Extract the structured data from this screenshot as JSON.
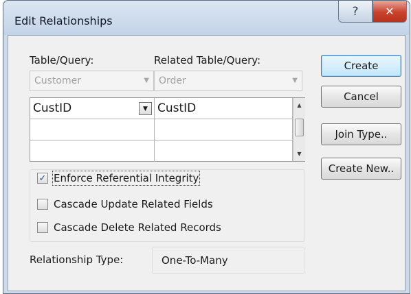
{
  "window": {
    "title": "Edit Relationships",
    "help_glyph": "?",
    "close_glyph": "✕"
  },
  "labels": {
    "table_query": "Table/Query:",
    "related_table_query": "Related Table/Query:",
    "relationship_type": "Relationship Type:"
  },
  "combos": {
    "table_value": "Customer",
    "related_value": "Order"
  },
  "fields_grid": {
    "rows": [
      {
        "left": "CustID",
        "right": "CustID"
      },
      {
        "left": "",
        "right": ""
      },
      {
        "left": "",
        "right": ""
      }
    ]
  },
  "options": {
    "enforce_integrity": {
      "label": "Enforce Referential Integrity",
      "checked": true
    },
    "cascade_update": {
      "label": "Cascade Update Related Fields",
      "checked": false
    },
    "cascade_delete": {
      "label": "Cascade Delete Related Records",
      "checked": false
    }
  },
  "relationship_type_value": "One-To-Many",
  "buttons": {
    "create": "Create",
    "cancel": "Cancel",
    "join_type": "Join Type..",
    "create_new": "Create New.."
  },
  "colors": {
    "title_bar": "#c3d3e7",
    "close_button": "#c8422c",
    "default_button_border": "#3c7fb1"
  }
}
